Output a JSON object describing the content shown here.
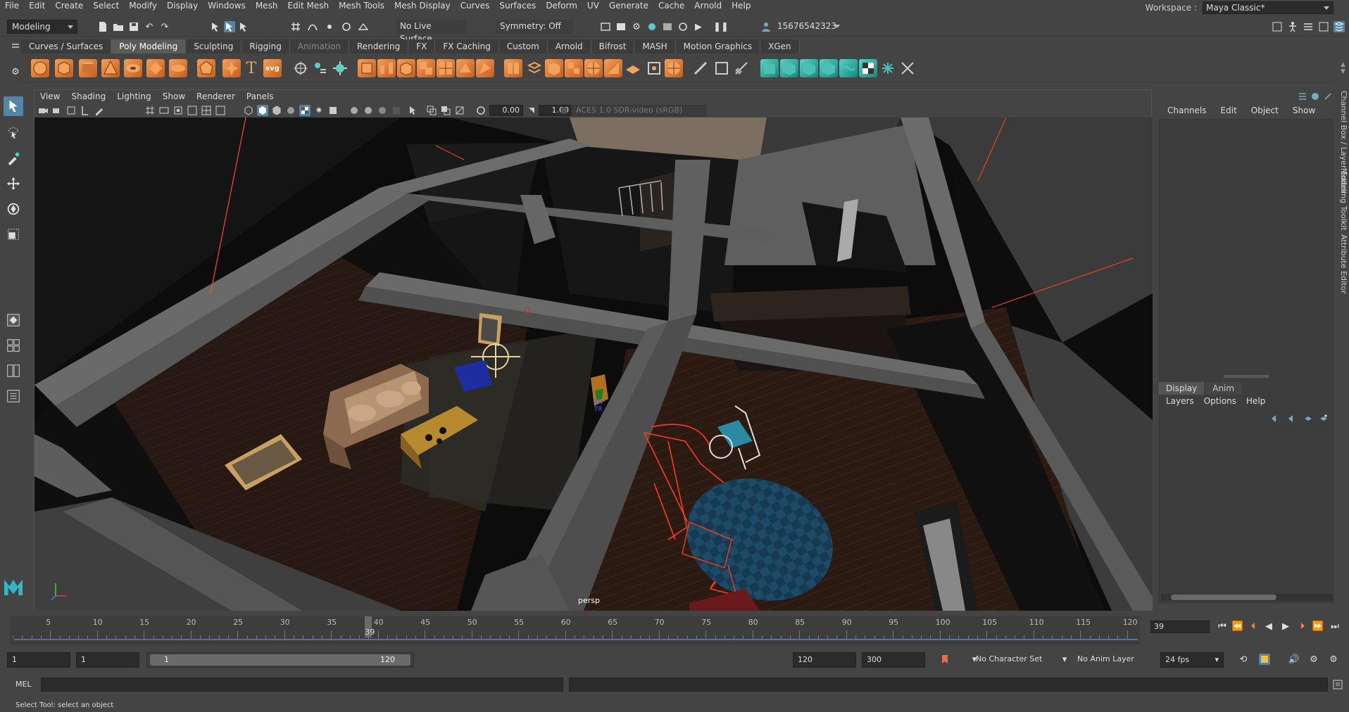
{
  "menu": [
    "File",
    "Edit",
    "Create",
    "Select",
    "Modify",
    "Display",
    "Windows",
    "Mesh",
    "Edit Mesh",
    "Mesh Tools",
    "Mesh Display",
    "Curves",
    "Surfaces",
    "Deform",
    "UV",
    "Generate",
    "Cache",
    "Arnold",
    "Help"
  ],
  "workspace": {
    "label": "Workspace :",
    "value": "Maya Classic*"
  },
  "status": {
    "mode": "Modeling",
    "live_surface": "No Live Surface",
    "symmetry": "Symmetry: Off",
    "user": "15676542323"
  },
  "shelf_tabs": [
    "Curves / Surfaces",
    "Poly Modeling",
    "Sculpting",
    "Rigging",
    "Animation",
    "Rendering",
    "FX",
    "FX Caching",
    "Custom",
    "Arnold",
    "Bifrost",
    "MASH",
    "Motion Graphics",
    "XGen"
  ],
  "shelf_active": "Poly Modeling",
  "viewport": {
    "menu": [
      "View",
      "Shading",
      "Lighting",
      "Show",
      "Renderer",
      "Panels"
    ],
    "gamma_value": "0.00",
    "exposure_value": "1.00",
    "color_management": "ACES 1.0 SDR-video (sRGB)",
    "camera_label": "persp",
    "annotation_1": "TR",
    "annotation_2": "TR"
  },
  "channel_box": {
    "menu": [
      "Channels",
      "Edit",
      "Object",
      "Show"
    ]
  },
  "layer_editor": {
    "tabs": [
      "Display",
      "Anim"
    ],
    "menu": [
      "Layers",
      "Options",
      "Help"
    ]
  },
  "side_tabs": [
    "Channel Box / Layer Editor",
    "Modeling Toolkit",
    "Attribute Editor"
  ],
  "timeline": {
    "ticks": [
      5,
      10,
      15,
      20,
      25,
      30,
      35,
      40,
      45,
      50,
      55,
      60,
      65,
      70,
      75,
      80,
      85,
      90,
      95,
      100,
      105,
      110,
      115,
      120
    ],
    "current": "39",
    "current_frame_field": "39"
  },
  "range": {
    "start": "1",
    "playback_start": "1",
    "slider_start": "1",
    "slider_end": "120",
    "playback_end": "120",
    "end": "300",
    "character_set": "No Character Set",
    "anim_layer": "No Anim Layer",
    "fps": "24 fps"
  },
  "cmd": {
    "lang": "MEL"
  },
  "help_text": "Select Tool: select an object"
}
